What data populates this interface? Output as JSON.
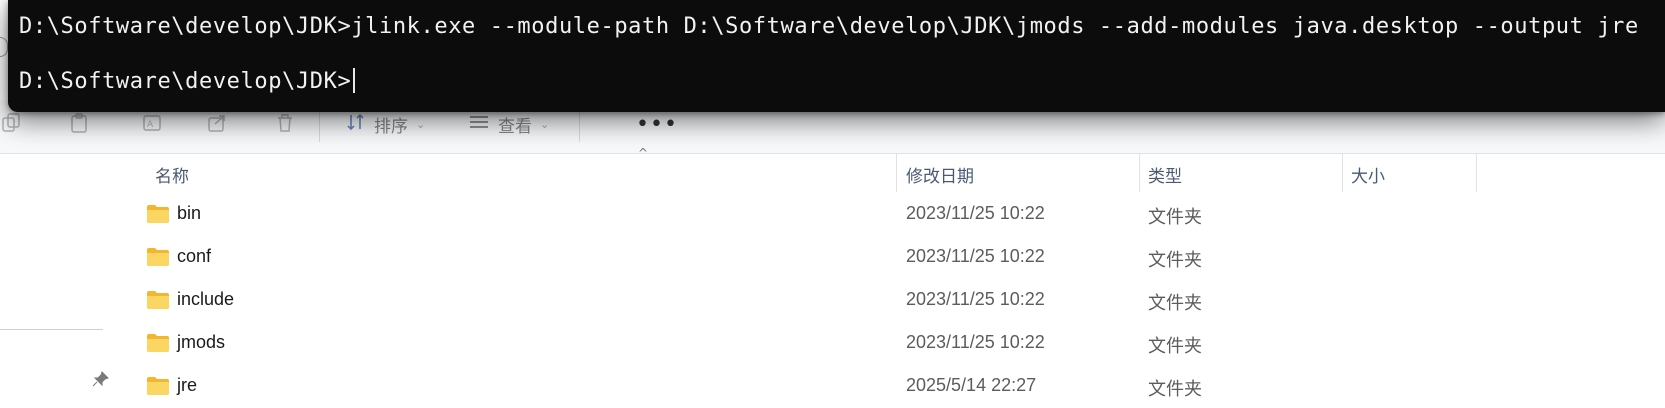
{
  "terminal": {
    "line1": "D:\\Software\\develop\\JDK>jlink.exe --module-path D:\\Software\\develop\\JDK\\jmods --add-modules java.desktop --output jre",
    "prompt": "D:\\Software\\develop\\JDK>"
  },
  "toolbar": {
    "sort_label": "排序",
    "view_label": "查看",
    "more_label": "•••"
  },
  "columns": {
    "name": "名称",
    "modified": "修改日期",
    "type": "类型",
    "size": "大小"
  },
  "files": [
    {
      "name": "bin",
      "modified": "2023/11/25 10:22",
      "type": "文件夹"
    },
    {
      "name": "conf",
      "modified": "2023/11/25 10:22",
      "type": "文件夹"
    },
    {
      "name": "include",
      "modified": "2023/11/25 10:22",
      "type": "文件夹"
    },
    {
      "name": "jmods",
      "modified": "2023/11/25 10:22",
      "type": "文件夹"
    },
    {
      "name": "jre",
      "modified": "2025/5/14 22:27",
      "type": "文件夹"
    }
  ],
  "icons": {
    "folder": "folder-icon",
    "pin": "pin-icon",
    "sort": "sort-icon",
    "view": "view-icon"
  },
  "colors": {
    "terminal_bg": "#0c0c0c",
    "terminal_text": "#f2f2f2",
    "folder_yellow": "#f7c948",
    "header_text": "#4a5a74"
  }
}
